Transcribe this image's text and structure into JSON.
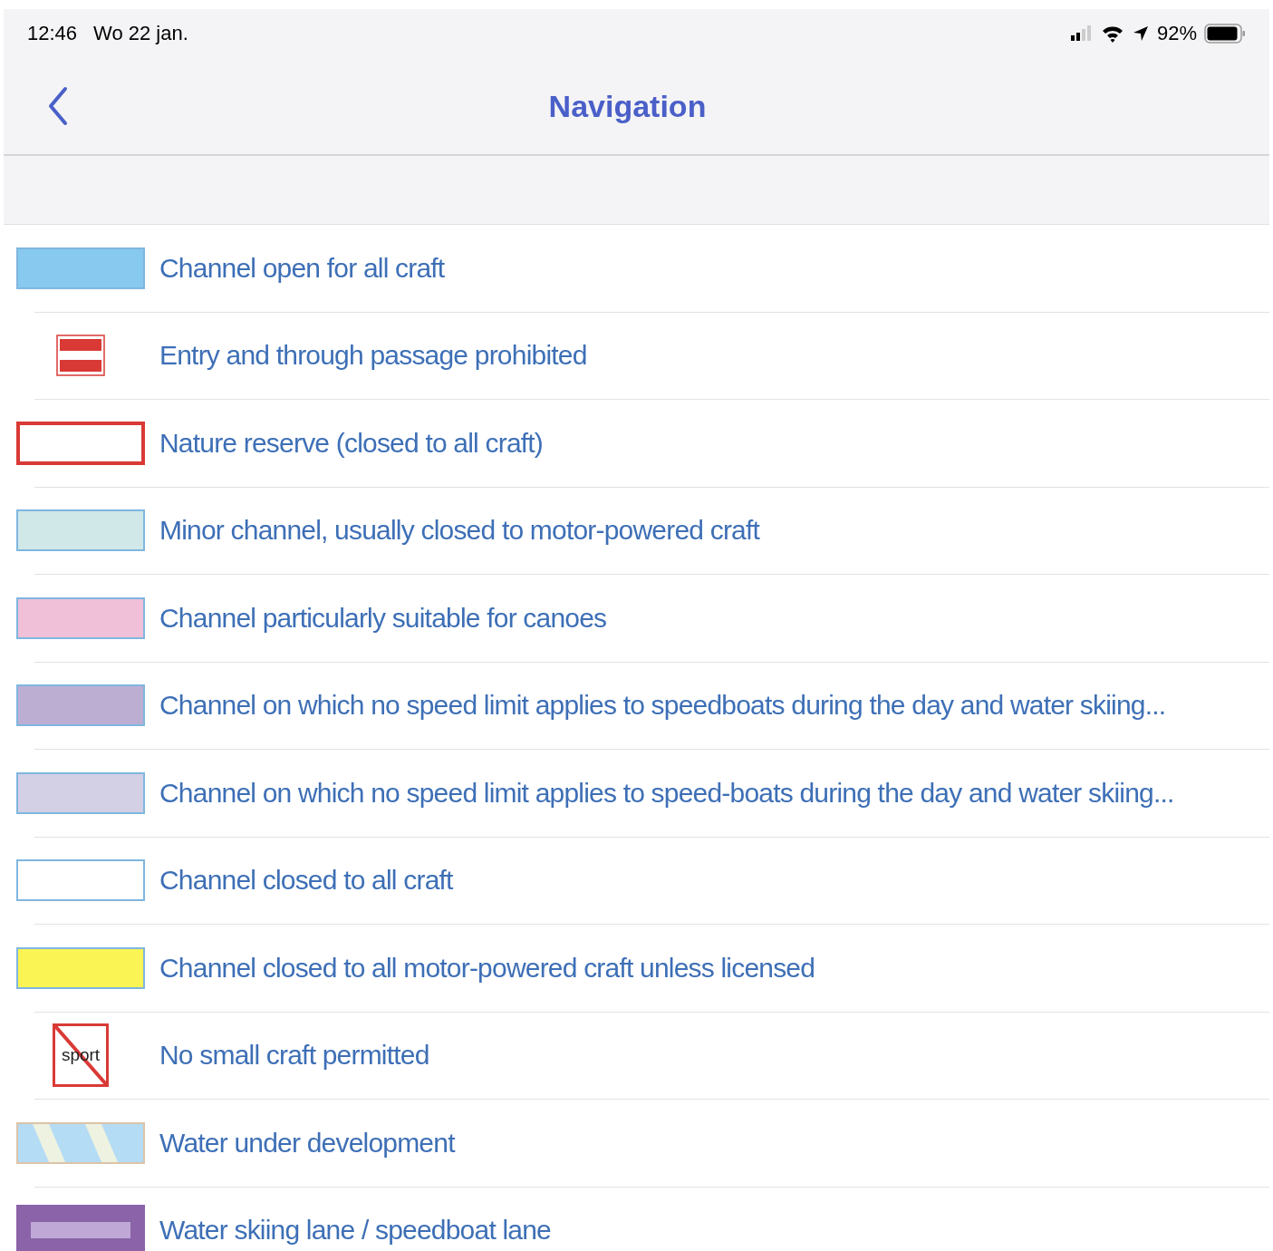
{
  "status_bar": {
    "time": "12:46",
    "date": "Wo 22 jan.",
    "battery": "92%"
  },
  "nav_bar": {
    "title": "Navigation"
  },
  "legend": [
    {
      "kind": "swatch",
      "color": "#87c9ef",
      "label": "Channel open for all craft"
    },
    {
      "kind": "no-entry-sign",
      "label": "Entry and through passage prohibited"
    },
    {
      "kind": "outline",
      "color": "#d93a36",
      "label": "Nature reserve (closed to all craft)"
    },
    {
      "kind": "swatch",
      "color": "#d0e8e8",
      "label": "Minor channel, usually closed to motor-powered craft"
    },
    {
      "kind": "swatch",
      "color": "#f0c0d8",
      "label": "Channel particularly suitable for canoes"
    },
    {
      "kind": "swatch",
      "color": "#bcaed3",
      "label": "Channel on which no speed limit applies to speedboats during the day and water skiing..."
    },
    {
      "kind": "swatch",
      "color": "#d3d0e6",
      "label": "Channel on which no speed limit applies to speed-boats during the day and water skiing..."
    },
    {
      "kind": "swatch",
      "color": "#ffffff",
      "label": "Channel closed to all craft"
    },
    {
      "kind": "swatch",
      "color": "#fbf455",
      "label": "Channel closed to all motor-powered craft unless licensed"
    },
    {
      "kind": "prohibited-sign",
      "sign_text": "sport",
      "label": "No small craft permitted"
    },
    {
      "kind": "hatched",
      "label": "Water under development"
    },
    {
      "kind": "lane",
      "label": "Water skiing lane / speedboat lane"
    }
  ]
}
